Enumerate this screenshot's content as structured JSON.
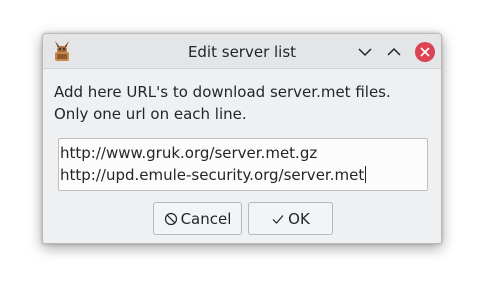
{
  "window": {
    "title": "Edit server list",
    "controls": {
      "minimize_icon": "chevron-down-icon",
      "maximize_icon": "chevron-up-icon",
      "close_icon": "close-icon"
    }
  },
  "description": {
    "line1": "Add here URL's to download server.met files.",
    "line2": "Only one url on each line."
  },
  "url_list": {
    "lines": [
      "http://www.gruk.org/server.met.gz",
      "http://upd.emule-security.org/server.met"
    ]
  },
  "buttons": {
    "cancel": {
      "label": "Cancel",
      "icon": "cancel-icon"
    },
    "ok": {
      "label": "OK",
      "icon": "check-icon"
    }
  },
  "colors": {
    "close_button": "#da4453",
    "window_background": "#eff0f1"
  }
}
